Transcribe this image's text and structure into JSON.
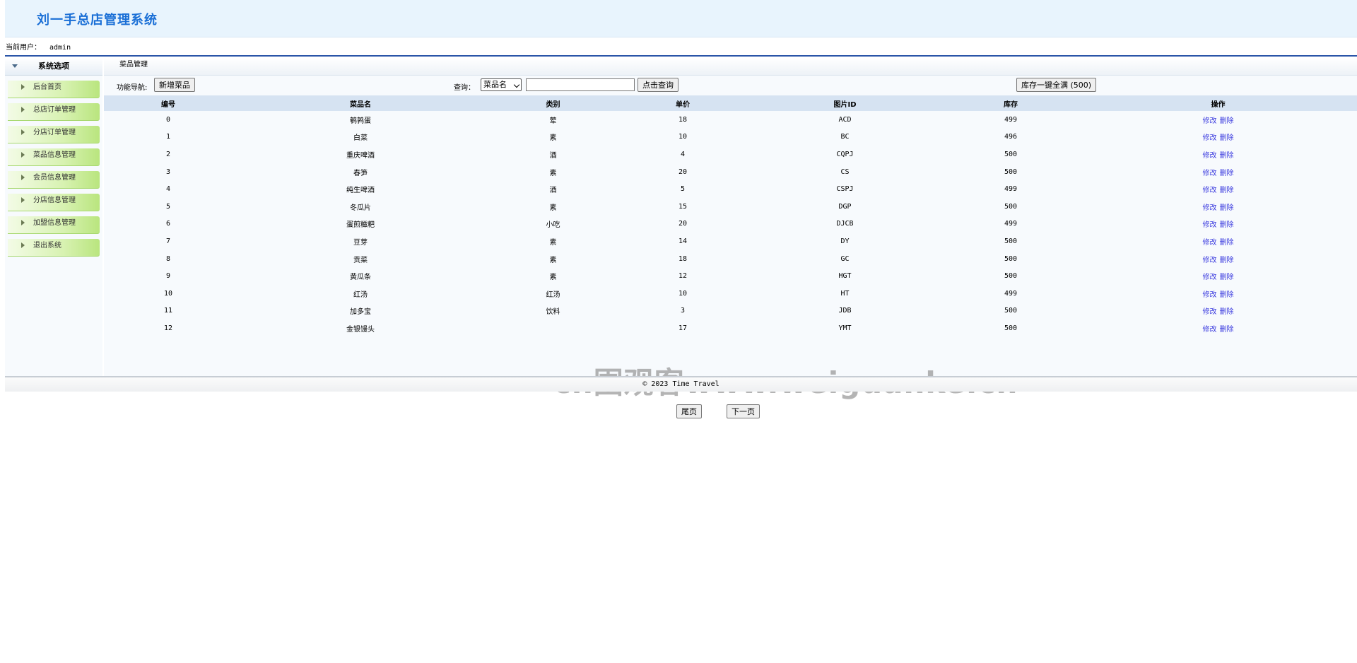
{
  "header": {
    "title": "刘一手总店管理系统"
  },
  "user_bar": {
    "label": "当前用户：",
    "username": "admin"
  },
  "sidebar": {
    "heading": "系统选项",
    "items": [
      {
        "label": "后台首页"
      },
      {
        "label": "总店订单管理"
      },
      {
        "label": "分店订单管理"
      },
      {
        "label": "菜品信息管理"
      },
      {
        "label": "会员信息管理"
      },
      {
        "label": "分店信息管理"
      },
      {
        "label": "加盟信息管理"
      },
      {
        "label": "退出系统"
      }
    ]
  },
  "main": {
    "breadcrumb": "菜品管理",
    "toolbar": {
      "nav_label": "功能导航:",
      "add_button": "新增菜品",
      "query_label": "查询：",
      "select_value": "菜品名",
      "search_value": "",
      "search_button": "点击查询",
      "restock_button": "库存一键全满 (500)"
    },
    "table": {
      "headers": [
        "编号",
        "菜品名",
        "类别",
        "单价",
        "图片ID",
        "库存",
        "操作"
      ],
      "edit_label": "修改",
      "delete_label": "删除",
      "rows": [
        [
          "0",
          "鹌鹑蛋",
          "荤",
          "18",
          "ACD",
          "499"
        ],
        [
          "1",
          "白菜",
          "素",
          "10",
          "BC",
          "496"
        ],
        [
          "2",
          "重庆啤酒",
          "酒",
          "4",
          "CQPJ",
          "500"
        ],
        [
          "3",
          "春笋",
          "素",
          "20",
          "CS",
          "500"
        ],
        [
          "4",
          "纯生啤酒",
          "酒",
          "5",
          "CSPJ",
          "499"
        ],
        [
          "5",
          "冬瓜片",
          "素",
          "15",
          "DGP",
          "500"
        ],
        [
          "6",
          "蛋煎糍粑",
          "小吃",
          "20",
          "DJCB",
          "499"
        ],
        [
          "7",
          "豆芽",
          "素",
          "14",
          "DY",
          "500"
        ],
        [
          "8",
          "贡菜",
          "素",
          "18",
          "GC",
          "500"
        ],
        [
          "9",
          "黄瓜条",
          "素",
          "12",
          "HGT",
          "500"
        ],
        [
          "10",
          "红汤",
          "红汤",
          "10",
          "HT",
          "499"
        ],
        [
          "11",
          "加多宝",
          "饮料",
          "3",
          "JDB",
          "500"
        ],
        [
          "12",
          "金银馒头",
          "",
          "17",
          "YMT",
          "500"
        ]
      ]
    },
    "pager": {
      "last": "尾页",
      "next": "下一页"
    }
  },
  "watermark": "cn围观客www.weiguanke.cn",
  "footer": {
    "text": "© 2023 Time Travel"
  }
}
